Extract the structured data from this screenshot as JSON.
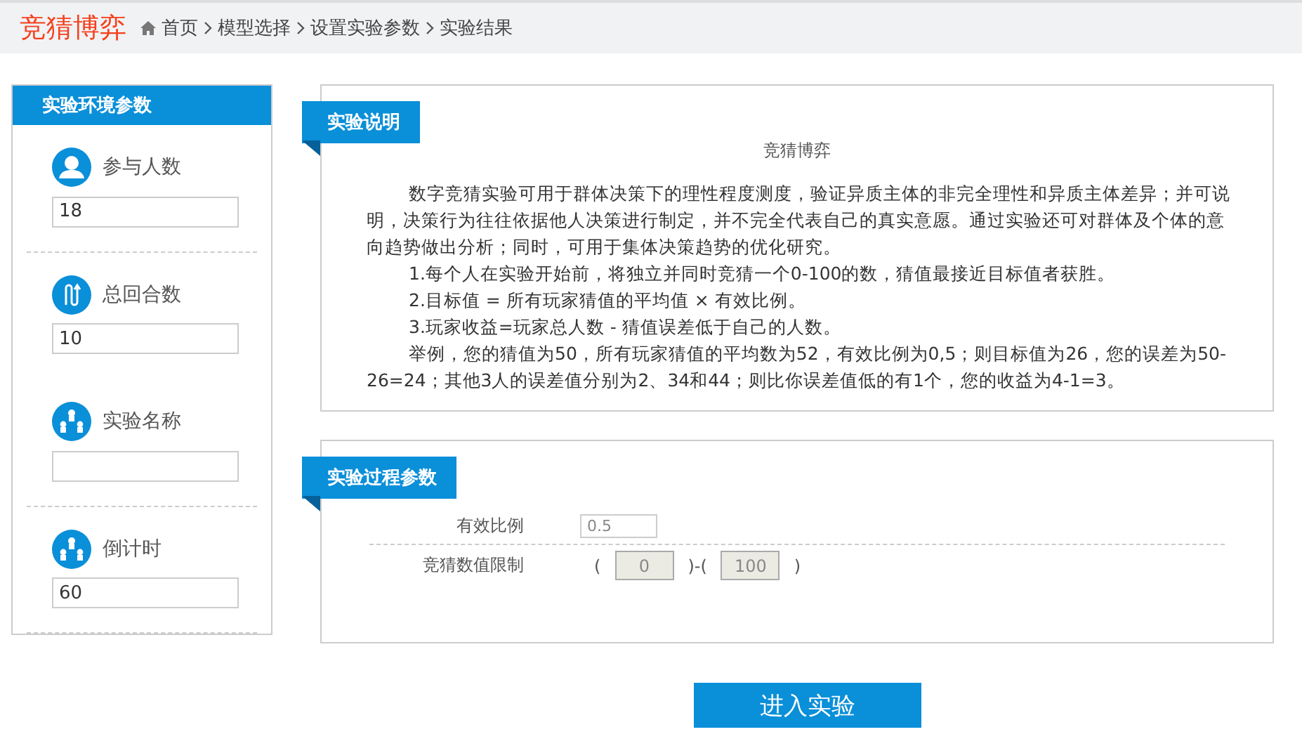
{
  "header": {
    "logo": "竞猜博弈",
    "breadcrumb": [
      "首页",
      "模型选择",
      "设置实验参数",
      "实验结果"
    ]
  },
  "sidebar": {
    "title": "实验环境参数",
    "params": [
      {
        "kind": "person",
        "label": "参与人数",
        "value": "18"
      },
      {
        "kind": "clip",
        "label": "总回合数",
        "value": "10"
      },
      {
        "kind": "team",
        "label": "实验名称"
      },
      {
        "kind": "team",
        "label": "倒计时",
        "value": "60"
      }
    ]
  },
  "description": {
    "tab": "实验说明",
    "title": "竞猜博弈",
    "paragraphs": [
      "数字竞猜实验可用于群体决策下的理性程度测度，验证异质主体的非完全理性和异质主体差异；并可说明，决策行为往往依据他人决策进行制定，并不完全代表自己的真实意愿。通过实验还可对群体及个体的意向趋势做出分析；同时，可用于集体决策趋势的优化研究。",
      "1.每个人在实验开始前，将独立并同时竞猜一个0-100的数，猜值最接近目标值者获胜。",
      "2.目标值 = 所有玩家猜值的平均值 × 有效比例。",
      "3.玩家收益=玩家总人数 - 猜值误差低于自己的人数。",
      "举例，您的猜值为50，所有玩家猜值的平均数为52，有效比例为0,5；则目标值为26，您的误差为50-26=24；其他3人的误差值分别为2、34和44；则比你误差值低的有1个，您的收益为4-1=3。"
    ]
  },
  "process": {
    "tab": "实验过程参数",
    "ratio": {
      "label": "有效比例",
      "value": "0.5"
    },
    "range": {
      "label": "竞猜数值限制",
      "open": "(",
      "sep": ")-(",
      "close": ")",
      "min": {
        "value": "0",
        "disabled": true
      },
      "max": {
        "value": "100",
        "disabled": true
      }
    }
  },
  "submit": "进入实验"
}
